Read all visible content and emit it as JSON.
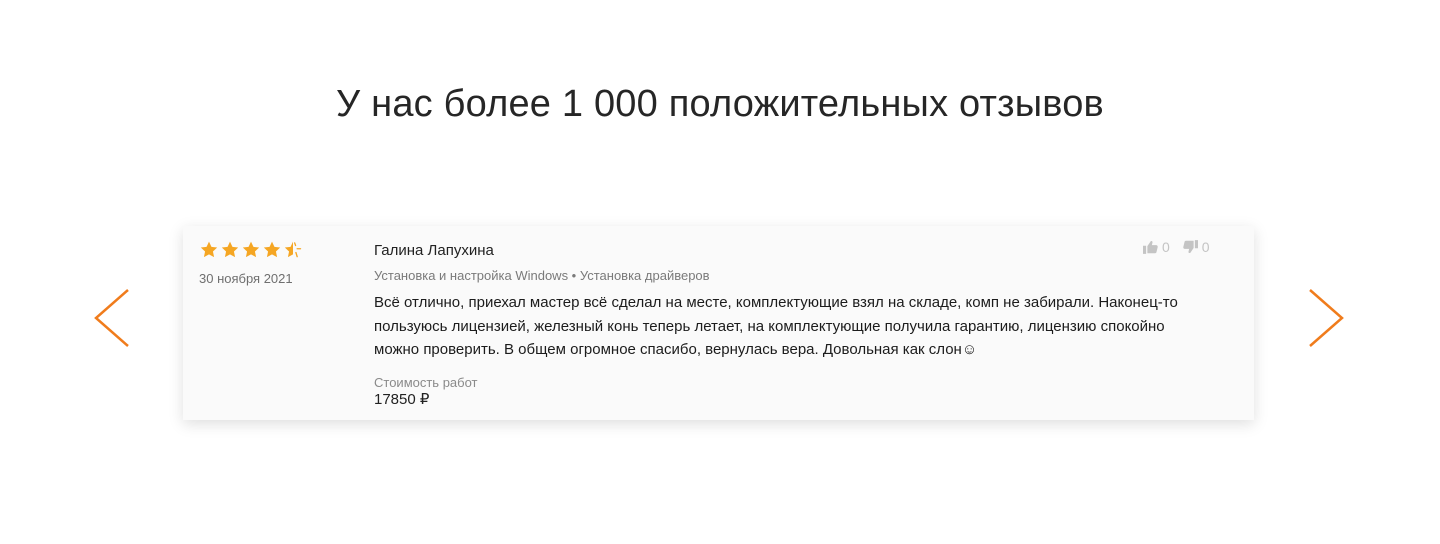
{
  "section": {
    "title": "У нас более 1 000 положительных отзывов"
  },
  "review": {
    "rating": 4.5,
    "rating_max": 5,
    "date": "30 ноября 2021",
    "author": "Галина Лапухина",
    "services": "Установка и настройка Windows • Установка драйверов",
    "text": "Всё отлично, приехал мастер всё сделал на месте, комплектующие взял на складе, комп не забирали. Наконец-то пользуюсь лицензией, железный конь теперь летает, на комплектующие получила гарантию, лицензию спокойно можно проверить. В общем огромное спасибо, вернулась вера. Довольная как слон☺",
    "cost_label": "Стоимость работ",
    "cost_value": "17850 ₽",
    "likes": "0",
    "dislikes": "0"
  },
  "icons": {
    "prev": "chevron-left-icon",
    "next": "chevron-right-icon",
    "star": "star-icon",
    "like": "thumbs-up-icon",
    "dislike": "thumbs-down-icon"
  },
  "colors": {
    "accent": "#f07c1c",
    "star": "#f5a623",
    "vote": "#c4c4c4"
  }
}
